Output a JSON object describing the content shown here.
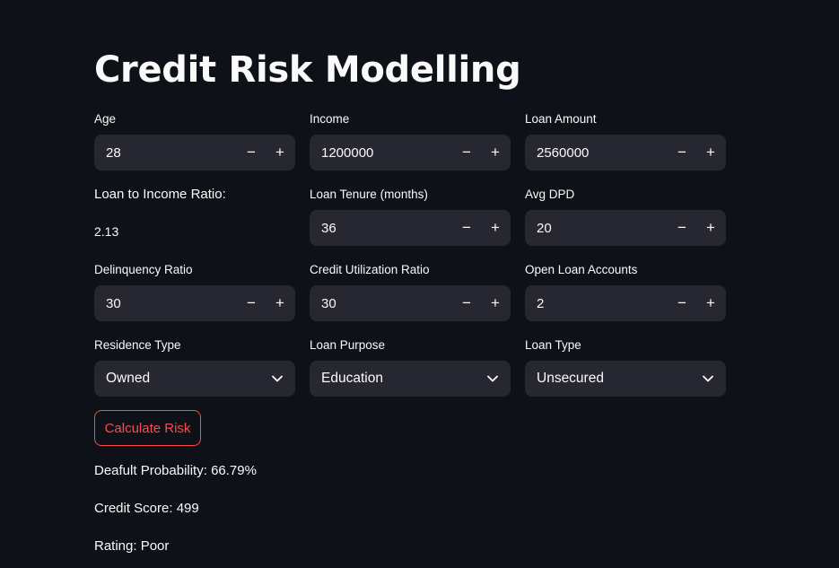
{
  "page": {
    "title": "Credit Risk Modelling"
  },
  "inputs": {
    "age": {
      "label": "Age",
      "value": "28"
    },
    "income": {
      "label": "Income",
      "value": "1200000"
    },
    "loan_amount": {
      "label": "Loan Amount",
      "value": "2560000"
    },
    "loan_tenure": {
      "label": "Loan Tenure (months)",
      "value": "36"
    },
    "avg_dpd": {
      "label": "Avg DPD",
      "value": "20"
    },
    "delinquency_ratio": {
      "label": "Delinquency Ratio",
      "value": "30"
    },
    "credit_utilization_ratio": {
      "label": "Credit Utilization Ratio",
      "value": "30"
    },
    "open_loan_accounts": {
      "label": "Open Loan Accounts",
      "value": "2"
    }
  },
  "loan_to_income": {
    "label": "Loan to Income Ratio:",
    "value": "2.13"
  },
  "selects": {
    "residence_type": {
      "label": "Residence Type",
      "value": "Owned"
    },
    "loan_purpose": {
      "label": "Loan Purpose",
      "value": "Education"
    },
    "loan_type": {
      "label": "Loan Type",
      "value": "Unsecured"
    }
  },
  "stepper": {
    "minus": "−",
    "plus": "+"
  },
  "actions": {
    "calculate_label": "Calculate Risk"
  },
  "results": {
    "default_probability": "Deafult Probability: 66.79%",
    "credit_score": "Credit Score: 499",
    "rating": "Rating: Poor"
  },
  "colors": {
    "background": "#0e1117",
    "input_bg": "#262730",
    "accent": "#ff4b4b",
    "text": "#fafafa"
  },
  "icons": {
    "select": "chevron-down-icon"
  }
}
